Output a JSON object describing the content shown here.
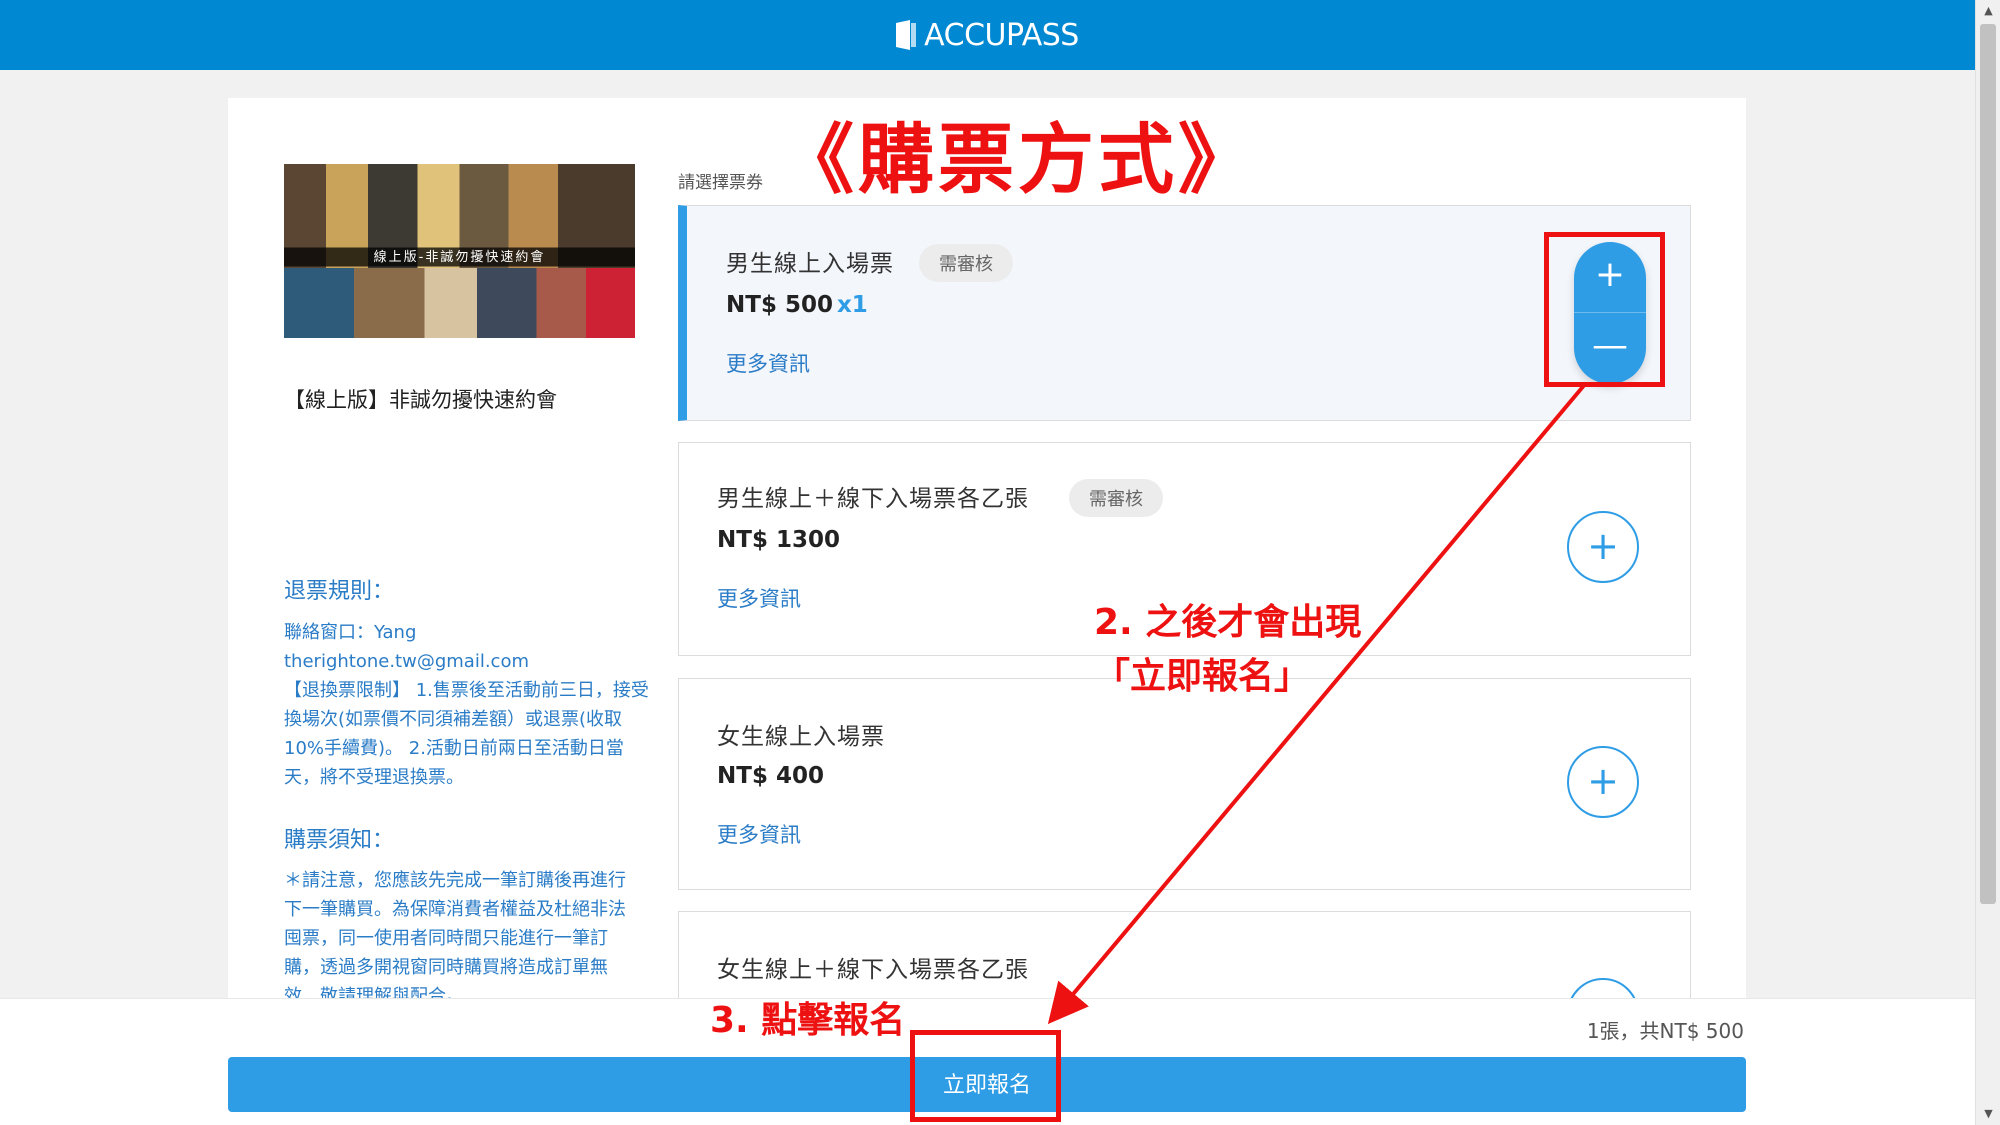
{
  "header": {
    "brand": "ACCUPASS",
    "brand_color": "#0088d2"
  },
  "event": {
    "image_banner_text": "線上版-非誠勿擾快速約會",
    "title": "【線上版】非誠勿擾快速約會"
  },
  "refund": {
    "heading": "退票規則：",
    "contact": "聯絡窗口：Yang",
    "email": "therightone.tw@gmail.com",
    "policy": "【退換票限制】 1.售票後至活動前三日，接受換場次(如票價不同須補差額）或退票(收取10%手續費)。 2.活動日前兩日至活動日當天，將不受理退換票。"
  },
  "notice": {
    "heading": "購票須知：",
    "body": "＊請注意，您應該先完成一筆訂購後再進行下一筆購買。為保障消費者權益及杜絕非法囤票，同一使用者同時間只能進行一筆訂購，透過多開視窗同時購買將造成訂單無效，敬請理解與配合。"
  },
  "tickets": {
    "select_label": "請選擇票券",
    "items": [
      {
        "name": "男生線上入場票",
        "badge": "需審核",
        "price": "NT$ 500",
        "qty": "x1",
        "more": "更多資訊",
        "selected": true
      },
      {
        "name": "男生線上＋線下入場票各乙張",
        "badge": "需審核",
        "price": "NT$ 1300",
        "more": "更多資訊"
      },
      {
        "name": "女生線上入場票",
        "price": "NT$ 400",
        "more": "更多資訊"
      },
      {
        "name": "女生線上＋線下入場票各乙張"
      }
    ]
  },
  "footer": {
    "summary": "1張，共NT$ 500",
    "register_label": "立即報名"
  },
  "annotations": {
    "title": "《購票方式》",
    "step2_line1": "2. 之後才會出現",
    "step2_line2": "「立即報名」",
    "step3": "3. 點擊報名",
    "color": "#ee1111"
  },
  "icons": {
    "plus": "+",
    "minus": "—"
  },
  "colors": {
    "accent": "#2e9de6",
    "link": "#2b7cc7"
  }
}
